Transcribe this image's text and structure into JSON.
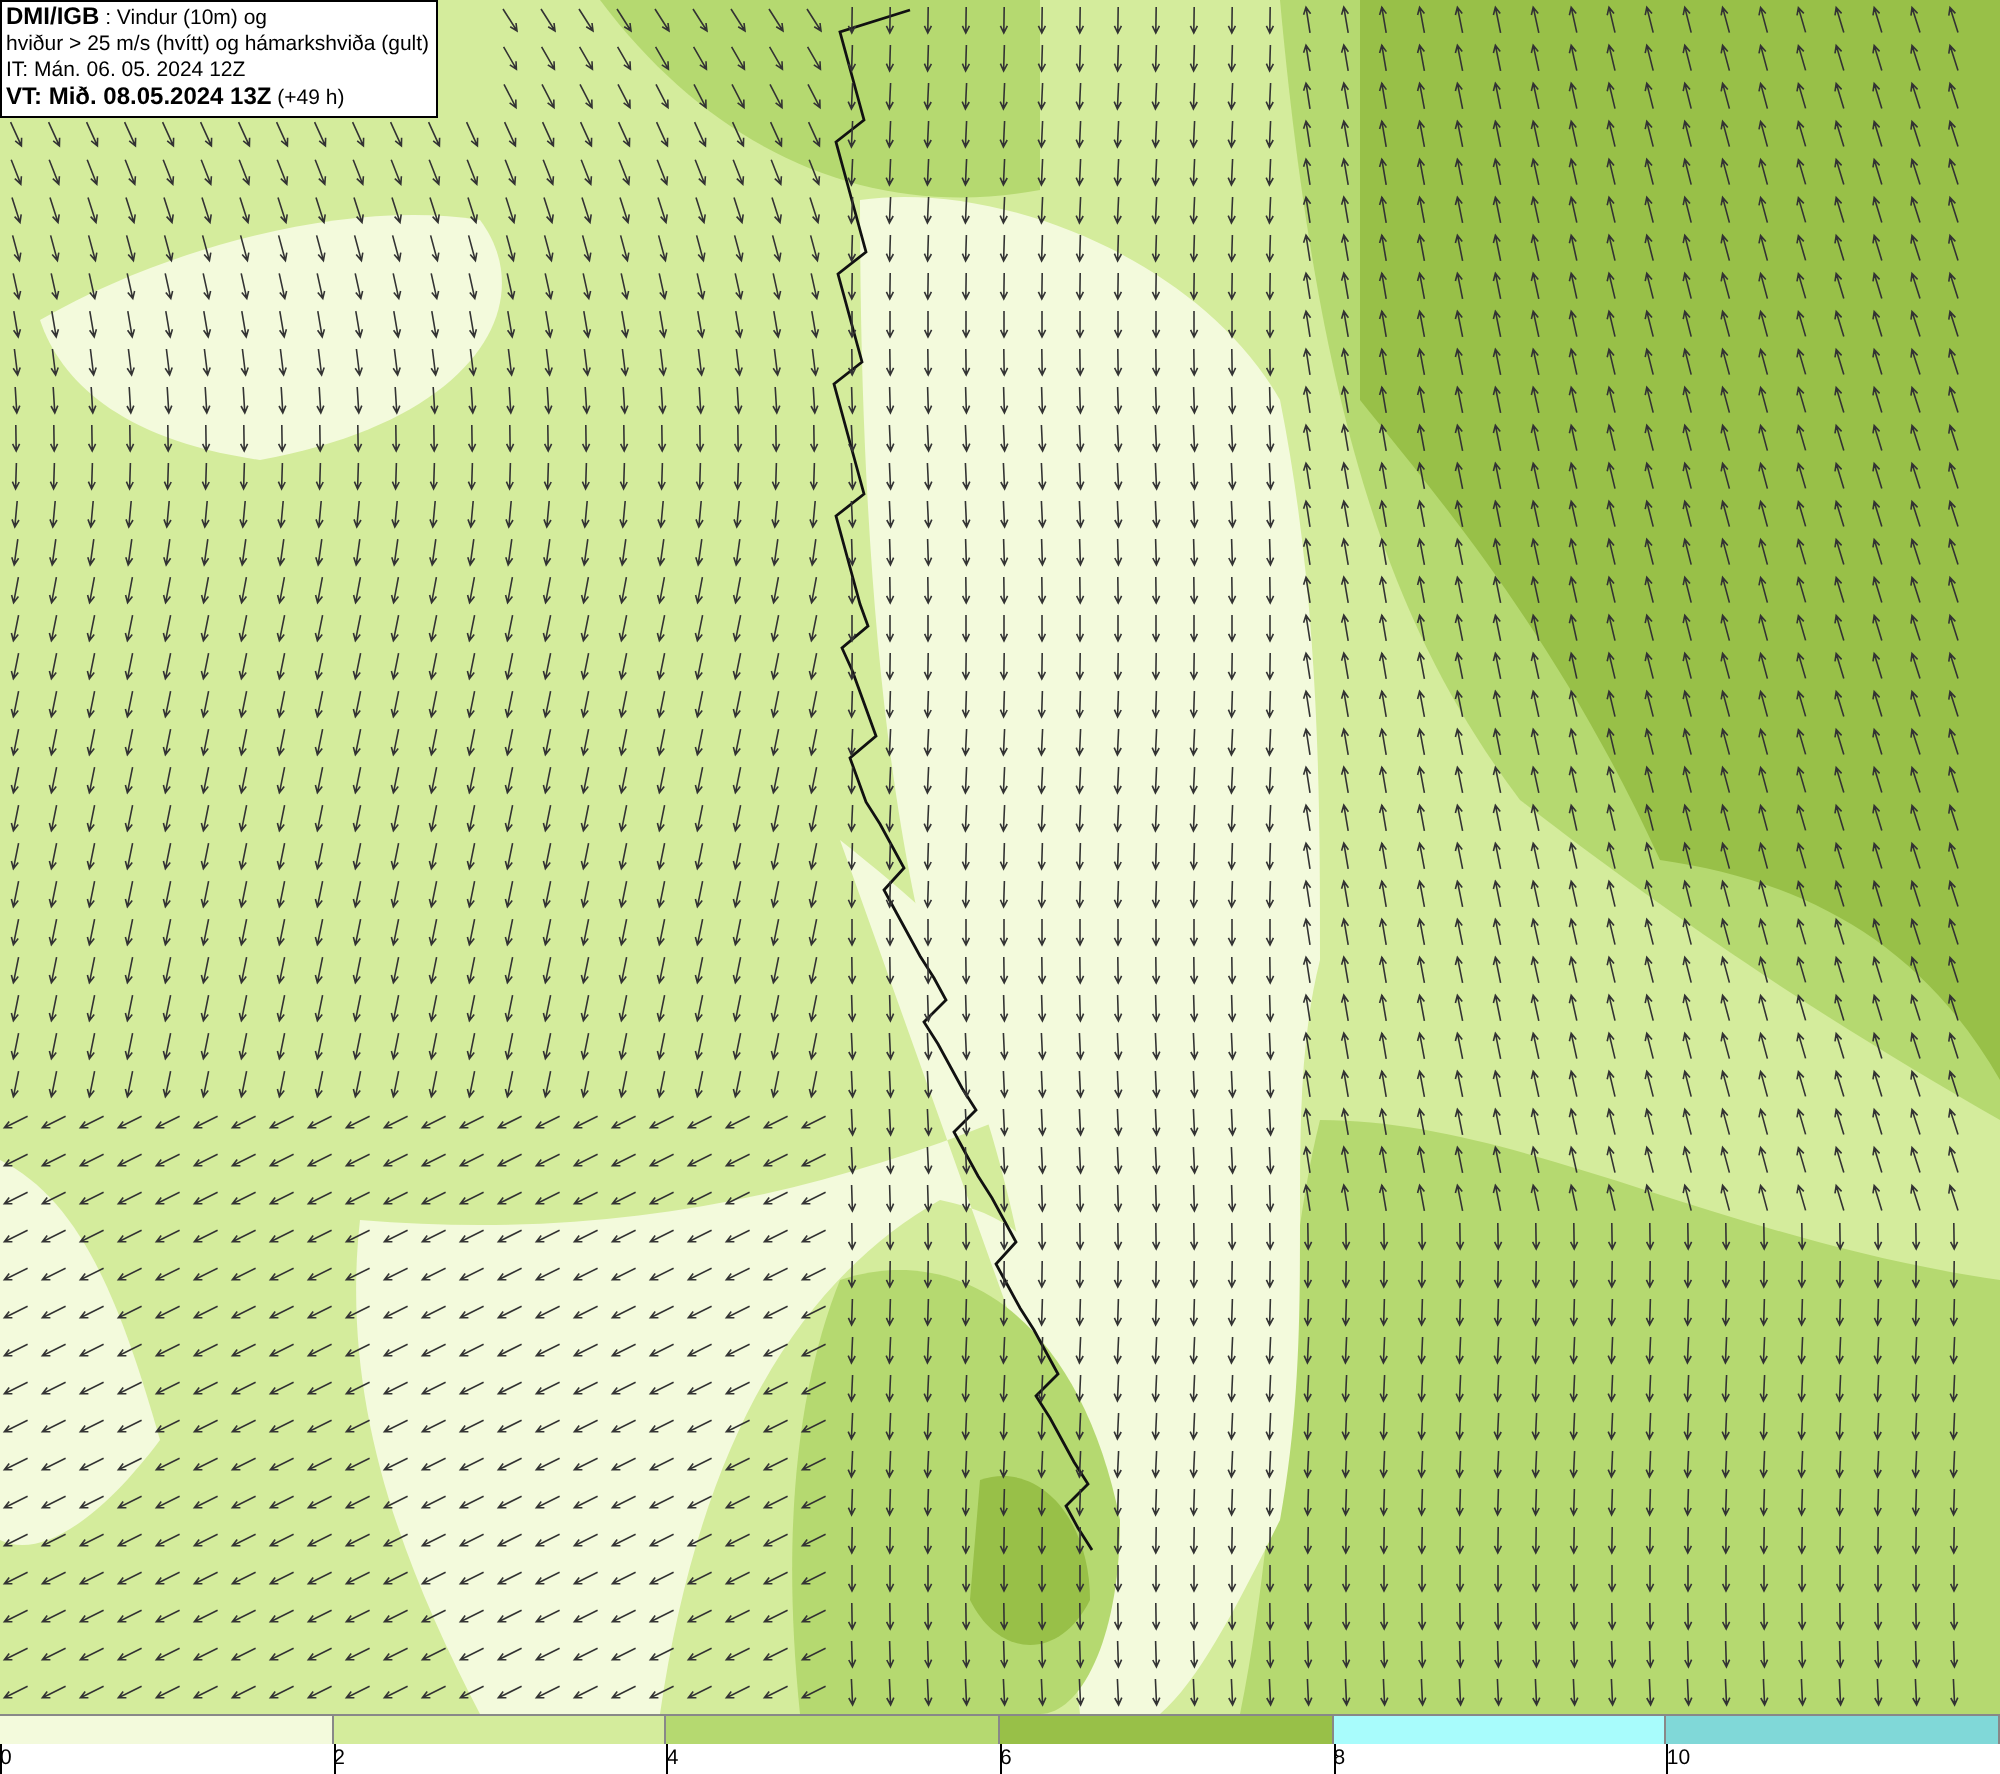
{
  "title_box": {
    "lines": [
      "**DMI/IGB** : Vindur (10m) og",
      "hviður > 25 m/s (hvítt) og hámarkshviða (gult)",
      "IT: Mán. 06. 05. 2024 12Z",
      "**VT: Mið. 08.05.2024 13Z** (+49 h)"
    ]
  },
  "legend": {
    "bins": [
      {
        "color": "#f3fadc"
      },
      {
        "color": "#d4ec9c"
      },
      {
        "color": "#b5d970"
      },
      {
        "color": "#98c048"
      },
      {
        "color": "#a8fcfc"
      },
      {
        "color": "#80d8d8"
      }
    ],
    "ticks": [
      "0",
      "2",
      "4",
      "6",
      "8",
      "10"
    ]
  }
}
